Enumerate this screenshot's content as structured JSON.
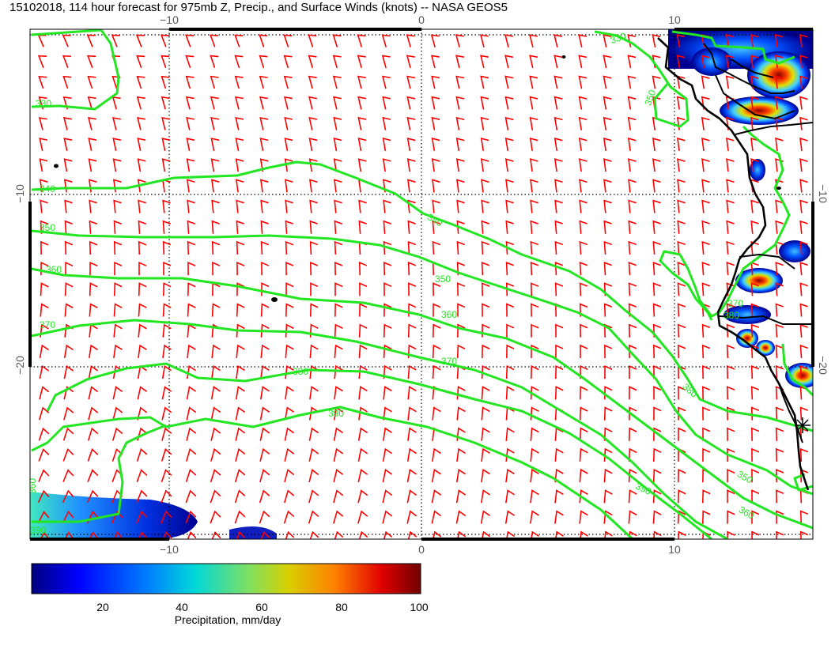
{
  "title": "15102018, 114 hour forecast for 975mb Z, Precip., and Surface Winds (knots) -- NASA GEOS5",
  "axes": {
    "top_ticks": [
      "−10",
      "0",
      "10"
    ],
    "bottom_ticks": [
      "−10",
      "0",
      "10"
    ],
    "left_ticks": [
      "−10",
      "−20"
    ],
    "right_ticks": [
      "−10",
      "−20"
    ]
  },
  "contour_labels": [
    "330",
    "340",
    "350",
    "360",
    "370",
    "380",
    "390",
    "390",
    "380",
    "360",
    "350",
    "360",
    "370",
    "330",
    "350",
    "340",
    "390",
    "350",
    "360",
    "370",
    "380"
  ],
  "colorbar": {
    "label": "Precipitation, mm/day",
    "ticks": [
      "20",
      "40",
      "60",
      "80",
      "100"
    ],
    "min": 0,
    "max": 100
  },
  "colors": {
    "contour": "#22e622",
    "barb": "#ff0000",
    "coast": "#000000"
  }
}
